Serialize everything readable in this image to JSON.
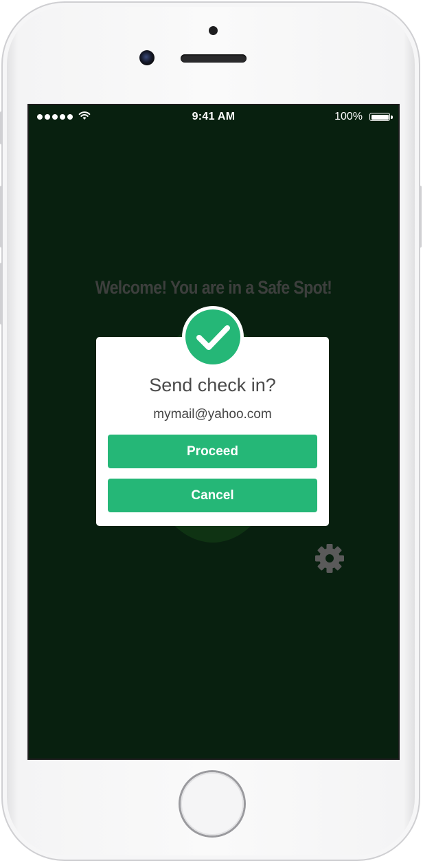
{
  "status_bar": {
    "time": "9:41 AM",
    "battery_percent": "100%"
  },
  "screen": {
    "welcome_text": "Welcome! You are in a Safe Spot!",
    "background_color": "#08200f"
  },
  "dialog": {
    "title": "Send check in?",
    "email": "mymail@yahoo.com",
    "proceed_label": "Proceed",
    "cancel_label": "Cancel",
    "accent_color": "#25b777"
  },
  "icons": {
    "badge": "checkmark-icon",
    "settings": "gear-icon",
    "signal": "signal-dots-icon",
    "wifi": "wifi-icon",
    "battery": "battery-icon"
  }
}
